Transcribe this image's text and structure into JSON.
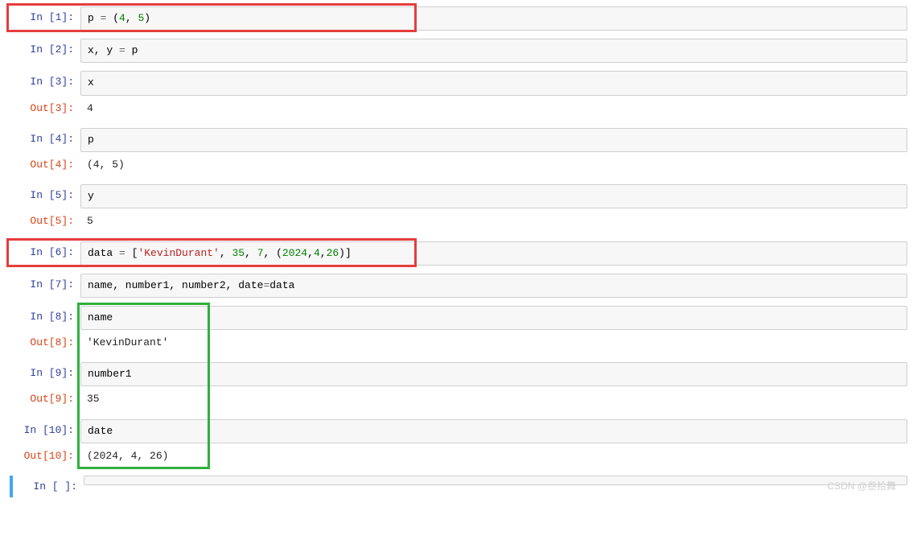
{
  "cells": [
    {
      "in_prompt": "In  [1]:",
      "code_html": "p <span class='tok-op'>=</span> (<span class='tok-num'>4</span>, <span class='tok-num'>5</span>)",
      "out_prompt": "",
      "out": ""
    },
    {
      "in_prompt": "In  [2]:",
      "code_html": "x, y <span class='tok-op'>=</span> p",
      "out_prompt": "",
      "out": ""
    },
    {
      "in_prompt": "In  [3]:",
      "code_html": "x",
      "out_prompt": "Out[3]:",
      "out": "4"
    },
    {
      "in_prompt": "In  [4]:",
      "code_html": "p",
      "out_prompt": "Out[4]:",
      "out": "(4, 5)"
    },
    {
      "in_prompt": "In  [5]:",
      "code_html": "y",
      "out_prompt": "Out[5]:",
      "out": "5"
    },
    {
      "in_prompt": "In  [6]:",
      "code_html": "data <span class='tok-op'>=</span> [<span class='tok-str'>'KevinDurant'</span>, <span class='tok-num'>35</span>, <span class='tok-num'>7</span>, (<span class='tok-num'>2024</span>,<span class='tok-num'>4</span>,<span class='tok-num'>26</span>)]",
      "out_prompt": "",
      "out": ""
    },
    {
      "in_prompt": "In  [7]:",
      "code_html": "name, number1, number2, date<span class='tok-op'>=</span>data",
      "out_prompt": "",
      "out": ""
    },
    {
      "in_prompt": "In  [8]:",
      "code_html": "name",
      "out_prompt": "Out[8]:",
      "out": "'KevinDurant'"
    },
    {
      "in_prompt": "In  [9]:",
      "code_html": "number1",
      "out_prompt": "Out[9]:",
      "out": "35"
    },
    {
      "in_prompt": "In [10]:",
      "code_html": "date",
      "out_prompt": "Out[10]:",
      "out": "(2024, 4, 26)"
    },
    {
      "in_prompt": "In  [ ]:",
      "code_html": "",
      "out_prompt": "",
      "out": ""
    }
  ],
  "watermark": "CSDN @叁拾舞",
  "highlight_red": [
    "0",
    "5"
  ],
  "highlight_green_span": [
    "7",
    "9"
  ]
}
